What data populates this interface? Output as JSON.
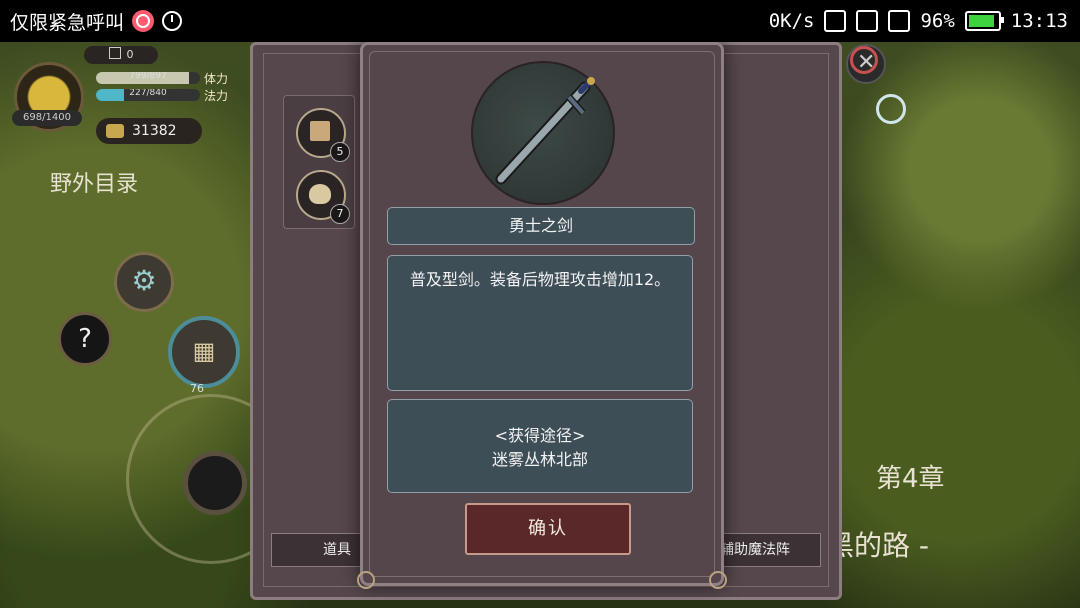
{
  "status_bar": {
    "emergency_text": "仅限紧急呼叫",
    "network_speed": "0K/s",
    "battery_percent": "96%",
    "time": "13:13"
  },
  "hud": {
    "level_value": "0",
    "hp_value": "698/1400",
    "stamina_value": "799/897",
    "stamina_label": "体力",
    "stamina_fill": 0.89,
    "mana_value": "227/840",
    "mana_label": "法力",
    "mana_fill": 0.27,
    "gold": "31382",
    "wild_catalog": "野外目录",
    "calendar_count": "76"
  },
  "background_panel": {
    "inventory": [
      {
        "icon": "book-scroll-icon",
        "count": "5"
      },
      {
        "icon": "pouch-icon",
        "count": "7"
      }
    ],
    "tabs": [
      "道具",
      "辅助魔法阵"
    ]
  },
  "chapter": {
    "number": "第4章",
    "title_fragment": "黑的路 -"
  },
  "dialog": {
    "item_icon": "sword-icon",
    "item_name": "勇士之剑",
    "description": "普及型剑。装备后物理攻击增加12。",
    "source_heading": "<获得途径>",
    "source_location": "迷雾丛林北部",
    "confirm_label": "确认"
  },
  "colors": {
    "dialog_bg": "#54464b",
    "box_bg": "#3e4e57",
    "confirm_bg": "#5a2828",
    "battery_green": "#3fd23f"
  }
}
